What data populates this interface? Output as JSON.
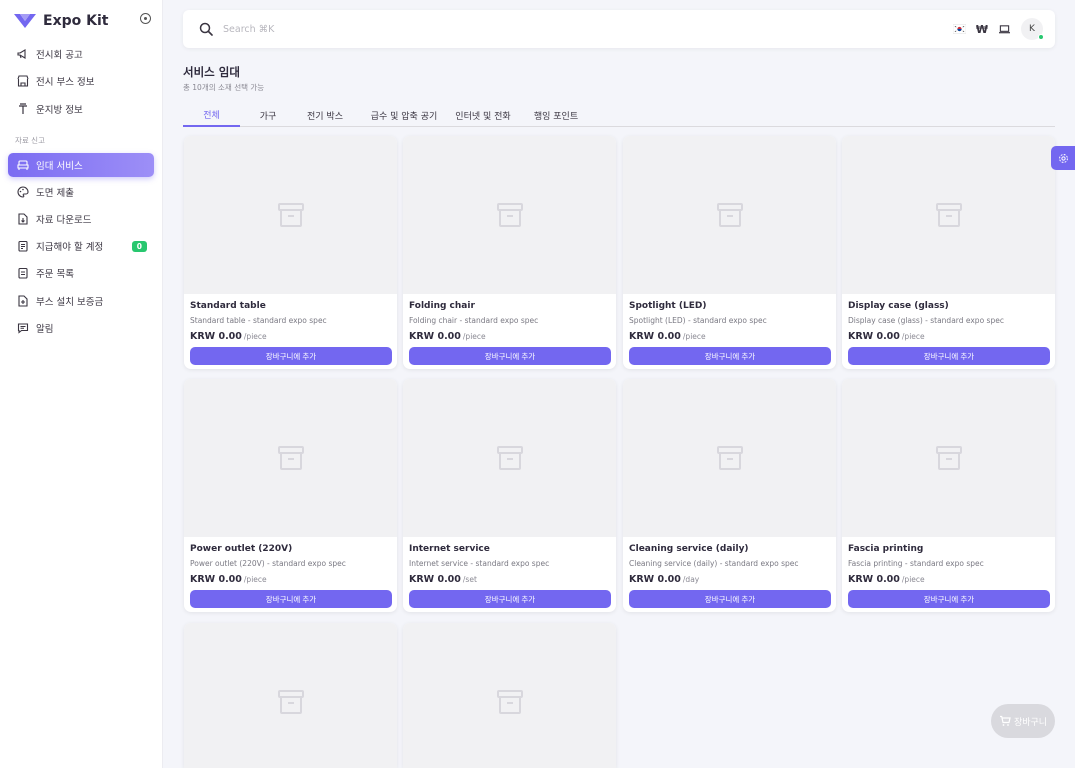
{
  "app": {
    "brand": "Expo Kit",
    "brand_color": "#7367f0"
  },
  "sidebar": {
    "items": [
      {
        "label": "전시회 공고",
        "icon": "megaphone-icon"
      },
      {
        "label": "전시 부스 정보",
        "icon": "store-icon"
      },
      {
        "label": "운지방 정보",
        "icon": "pin-icon"
      }
    ],
    "section_label": "자료 신고",
    "section_items": [
      {
        "label": "임대 서비스",
        "icon": "armchair-icon",
        "active": true
      },
      {
        "label": "도면 제출",
        "icon": "palette-icon"
      },
      {
        "label": "자료 다운로드",
        "icon": "file-download-icon"
      },
      {
        "label": "지급해야 할 계정",
        "icon": "clipboard-icon",
        "badge": "0"
      },
      {
        "label": "주문 목록",
        "icon": "list-icon"
      },
      {
        "label": "부스 설치 보증금",
        "icon": "file-deposit-icon"
      },
      {
        "label": "알림",
        "icon": "message-icon"
      }
    ]
  },
  "topbar": {
    "search_placeholder": "Search ⌘K",
    "language_icon": "korea-flag-icon",
    "currency_symbol": "₩",
    "device_icon": "laptop-icon",
    "avatar_initial": "K",
    "status_color": "#28c76f"
  },
  "header": {
    "title": "서비스 임대",
    "subtitle": "총 10개의 소재 선택 가능"
  },
  "tabs": [
    "전체",
    "가구",
    "전기 박스",
    "급수 및 압축 공기",
    "인터넷 및 전화",
    "행잉 포인트"
  ],
  "active_tab": "전체",
  "cards": [
    {
      "name": "Standard table",
      "desc": "Standard table - standard expo spec",
      "price": "KRW 0.00",
      "unit": "/piece",
      "button": "장바구니에 추가"
    },
    {
      "name": "Folding chair",
      "desc": "Folding chair - standard expo spec",
      "price": "KRW 0.00",
      "unit": "/piece",
      "button": "장바구니에 추가"
    },
    {
      "name": "Spotlight (LED)",
      "desc": "Spotlight (LED) - standard expo spec",
      "price": "KRW 0.00",
      "unit": "/piece",
      "button": "장바구니에 추가"
    },
    {
      "name": "Display case (glass)",
      "desc": "Display case (glass) - standard expo spec",
      "price": "KRW 0.00",
      "unit": "/piece",
      "button": "장바구니에 추가"
    },
    {
      "name": "Power outlet (220V)",
      "desc": "Power outlet (220V) - standard expo spec",
      "price": "KRW 0.00",
      "unit": "/piece",
      "button": "장바구니에 추가"
    },
    {
      "name": "Internet service",
      "desc": "Internet service - standard expo spec",
      "price": "KRW 0.00",
      "unit": "/set",
      "button": "장바구니에 추가"
    },
    {
      "name": "Cleaning service (daily)",
      "desc": "Cleaning service (daily) - standard expo spec",
      "price": "KRW 0.00",
      "unit": "/day",
      "button": "장바구니에 추가"
    },
    {
      "name": "Fascia printing",
      "desc": "Fascia printing - standard expo spec",
      "price": "KRW 0.00",
      "unit": "/piece",
      "button": "장바구니에 추가"
    }
  ],
  "partial_cards_count_visible": 2,
  "floating": {
    "cart_label": "장바구니",
    "settings_icon": "gear-icon",
    "cart_icon": "cart-icon"
  }
}
